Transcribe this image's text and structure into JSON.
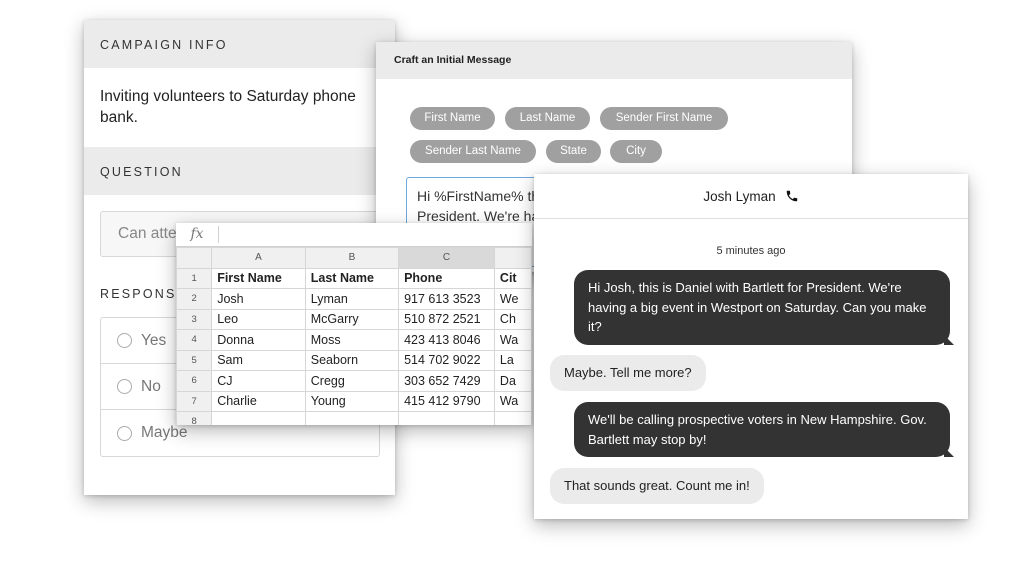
{
  "campaign": {
    "info_heading": "CAMPAIGN INFO",
    "info_text": "Inviting volunteers to Saturday phone bank.",
    "question_heading": "QUESTION",
    "question_value": "Can atte",
    "responses_heading": "RESPONS",
    "responses": [
      "Yes",
      "No",
      "Maybe"
    ]
  },
  "message": {
    "heading": "Craft an Initial Message",
    "tokens": [
      "First Name",
      "Last Name",
      "Sender First Name",
      "Sender Last Name",
      "State",
      "City"
    ],
    "body_line1": "Hi %FirstName% th",
    "body_line2": "President. We're ha"
  },
  "sheet": {
    "fx_label": "fx",
    "columns": [
      "A",
      "B",
      "C",
      ""
    ],
    "rows": [
      {
        "n": "1",
        "cells": [
          "First Name",
          "Last Name",
          "Phone",
          "Cit"
        ]
      },
      {
        "n": "2",
        "cells": [
          "Josh",
          "Lyman",
          "917 613 3523",
          "We"
        ]
      },
      {
        "n": "3",
        "cells": [
          "Leo",
          "McGarry",
          "510 872 2521",
          "Ch"
        ]
      },
      {
        "n": "4",
        "cells": [
          "Donna",
          "Moss",
          "423 413 8046",
          "Wa"
        ]
      },
      {
        "n": "5",
        "cells": [
          "Sam",
          "Seaborn",
          "514 702 9022",
          "La"
        ]
      },
      {
        "n": "6",
        "cells": [
          "CJ",
          "Cregg",
          "303 652 7429",
          "Da"
        ]
      },
      {
        "n": "7",
        "cells": [
          "Charlie",
          "Young",
          "415 412 9790",
          "Wa"
        ]
      },
      {
        "n": "8",
        "cells": [
          "",
          "",
          "",
          ""
        ]
      }
    ]
  },
  "chat": {
    "contact": "Josh Lyman",
    "icon": "phone-icon",
    "timestamp": "5 minutes ago",
    "messages": [
      {
        "dir": "out",
        "text": "Hi Josh, this is Daniel with Bartlett for President. We're having a big event in Westport on Saturday. Can you make it?"
      },
      {
        "dir": "in",
        "text": "Maybe. Tell me more?"
      },
      {
        "dir": "out",
        "text": "We'll be calling prospective voters in New Hampshire. Gov. Bartlett may stop by!"
      },
      {
        "dir": "in",
        "text": "That sounds great. Count me in!"
      }
    ]
  }
}
